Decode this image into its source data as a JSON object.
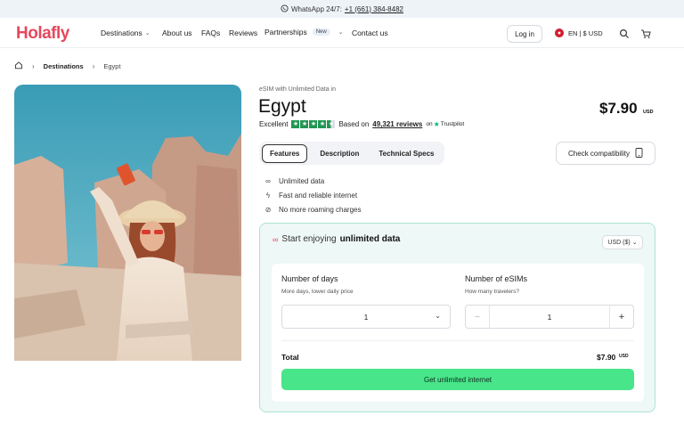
{
  "topbar": {
    "whatsapp_label": "WhatsApp 24/7:",
    "phone": "+1 (661) 384-8482"
  },
  "nav": {
    "logo": "Holafly",
    "items": [
      {
        "label": "Destinations"
      },
      {
        "label": "About us"
      },
      {
        "label": "FAQs"
      },
      {
        "label": "Reviews"
      },
      {
        "label": "Partnerships",
        "badge": "New"
      },
      {
        "label": "Contact us"
      }
    ],
    "login": "Log in",
    "lang_currency": "EN | $ USD"
  },
  "breadcrumb": {
    "destinations": "Destinations",
    "current": "Egypt"
  },
  "product": {
    "subtitle": "eSIM with Unlimited Data in",
    "title": "Egypt",
    "rating_word": "Excellent",
    "stars": 4.5,
    "based_on": "Based on",
    "reviews": "49,321 reviews",
    "on": "on",
    "trustpilot": "Trustpilot",
    "price": "$7.90",
    "price_currency": "USD"
  },
  "tabs": [
    {
      "label": "Features",
      "active": true
    },
    {
      "label": "Description",
      "active": false
    },
    {
      "label": "Technical Specs",
      "active": false
    }
  ],
  "check_compat": "Check compatibility",
  "features": [
    {
      "icon": "infinity-icon",
      "text": "Unlimited data"
    },
    {
      "icon": "lightning-icon",
      "text": "Fast and reliable internet"
    },
    {
      "icon": "no-roaming-icon",
      "text": "No more roaming charges"
    }
  ],
  "card": {
    "head_prefix": "Start enjoying",
    "head_bold": "unlimited data",
    "currency_select": "USD ($)",
    "days_label": "Number of days",
    "days_hint": "More days, lower daily price",
    "days_value": "1",
    "esims_label": "Number of eSIMs",
    "esims_hint": "How many travelers?",
    "esims_value": "1",
    "total_label": "Total",
    "total_value": "$7.90",
    "total_currency": "USD",
    "cta": "Get unlimited internet"
  },
  "colors": {
    "brand": "#e6485e",
    "cta": "#48e58a",
    "card_bg": "#eef8f6",
    "trustpilot": "#219653"
  }
}
